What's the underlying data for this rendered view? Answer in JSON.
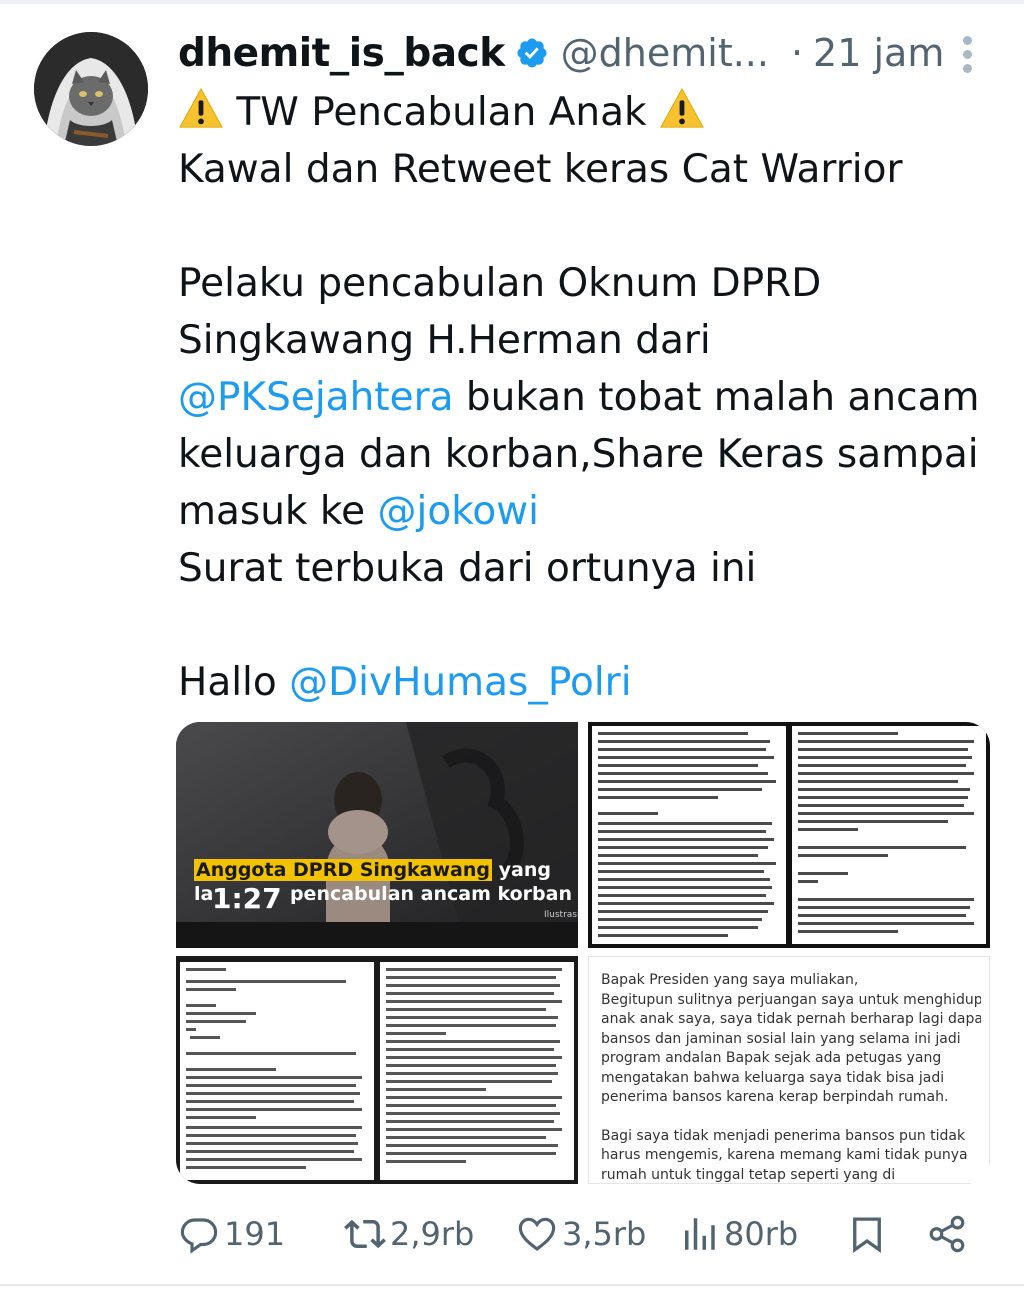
{
  "tweet": {
    "author": {
      "display_name": "dhemit_is_back",
      "handle": "@dhemit...",
      "verified": true,
      "avatar_icon": "hooded-cat-avatar"
    },
    "separator": "·",
    "time": "21 jam",
    "text": {
      "line1": "TW Pencabulan Anak",
      "line2": "Kawal dan Retweet keras Cat Warrior",
      "line3": "Pelaku pencabulan Oknum DPRD",
      "line4": "Singkawang H.Herman dari",
      "line5_mention": "@PKSejahtera",
      "line5_rest": " bukan tobat malah ancam",
      "line6": "keluarga dan korban,Share Keras sampai",
      "line7_pre": "masuk ke ",
      "line7_mention": "@jokowi",
      "line8": "Surat terbuka dari ortunya ini",
      "line9_pre": "Hallo ",
      "line9_mention": "@DivHumas_Polri"
    },
    "media": {
      "video": {
        "caption_highlight": "Anggota DPRD Singkawang",
        "caption_rest1": " yang",
        "caption_line2_pre": "la",
        "caption_line2_post": " pencabulan ancam korban",
        "duration": "1:27",
        "watermark": "Ilustrasi"
      },
      "letter": {
        "lines": [
          "Bapak Presiden yang saya muliakan,",
          "Begitupun sulitnya perjuangan saya untuk menghidupi",
          "anak anak  saya, saya tidak pernah berharap lagi dapat",
          "bansos dan jaminan sosial lain yang selama ini jadi",
          "program andalan Bapak sejak ada petugas yang",
          "mengatakan bahwa  keluarga saya tidak bisa jadi",
          "penerima bansos karena kerap berpindah rumah.",
          "",
          "Bagi saya tidak menjadi penerima bansos pun tidak",
          "harus mengemis, karena memang kami tidak punya",
          "rumah untuk tinggal tetap seperti yang  di"
        ]
      }
    },
    "actions": {
      "replies": "191",
      "retweets": "2,9rb",
      "likes": "3,5rb",
      "views": "80rb"
    },
    "colors": {
      "mention": "#1d9bf0",
      "verified": "#1d9bf0",
      "secondary_text": "#536471"
    }
  }
}
